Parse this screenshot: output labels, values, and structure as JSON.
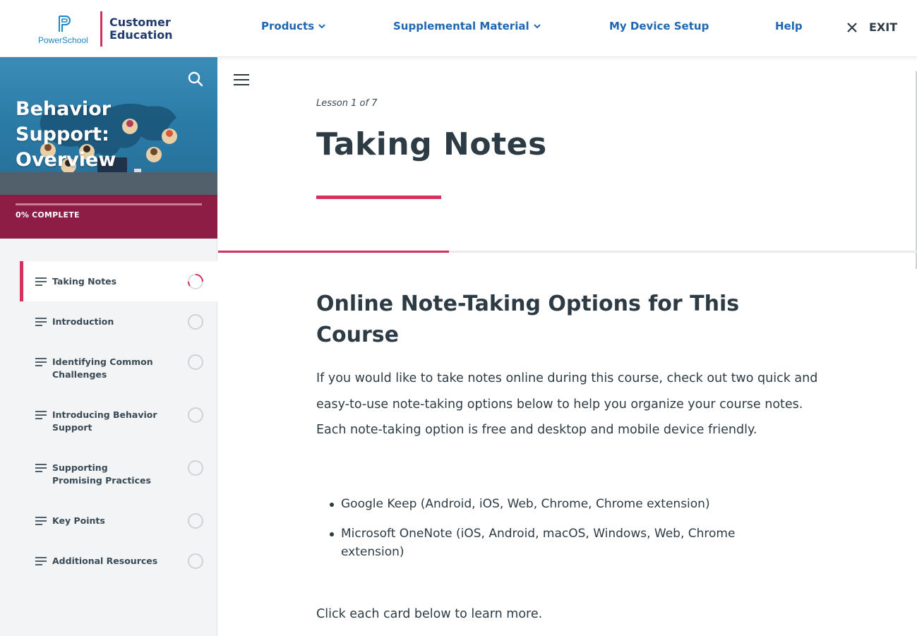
{
  "header": {
    "brand_mark": "PowerSchool",
    "brand_line1": "Customer",
    "brand_line2": "Education",
    "nav": [
      {
        "label": "Products",
        "has_dropdown": true
      },
      {
        "label": "Supplemental Material",
        "has_dropdown": true
      },
      {
        "label": "My Device Setup",
        "has_dropdown": false
      },
      {
        "label": "Help",
        "has_dropdown": false
      }
    ],
    "exit_label": "EXIT"
  },
  "sidebar": {
    "course_title": "Behavior Support: Overview",
    "progress_label": "0% COMPLETE",
    "progress_percent": 0,
    "lessons": [
      {
        "label": "Taking Notes",
        "status": "in-progress",
        "active": true
      },
      {
        "label": "Introduction",
        "status": "not-started",
        "active": false
      },
      {
        "label": "Identifying Common Challenges",
        "status": "not-started",
        "active": false
      },
      {
        "label": "Introducing Behavior Support",
        "status": "not-started",
        "active": false
      },
      {
        "label": "Supporting Promising Practices",
        "status": "not-started",
        "active": false
      },
      {
        "label": "Key Points",
        "status": "not-started",
        "active": false
      },
      {
        "label": "Additional Resources",
        "status": "not-started",
        "active": false
      }
    ]
  },
  "main": {
    "lesson_counter": "Lesson 1 of 7",
    "lesson_title": "Taking Notes",
    "lesson_progress_fraction": 0.33,
    "section_heading": "Online Note-Taking Options for This Course",
    "intro_paragraph": "If you would like to take notes online during this course, check out two quick and easy-to-use note-taking options below to help you organize your course notes. Each note-taking option is free and desktop and mobile device friendly.",
    "options": [
      "Google Keep (Android, iOS, Web, Chrome, Chrome extension)",
      "Microsoft OneNote (iOS, Android, macOS, Windows, Web, Chrome extension)"
    ],
    "click_note": "Click each card below to learn more."
  },
  "colors": {
    "accent": "#d6305f",
    "nav_blue": "#1d67b2",
    "progress_bg": "#8e1d46",
    "text": "#2d3b45"
  },
  "icons": {
    "search": "search-icon",
    "menu": "hamburger-menu-icon",
    "close": "close-icon",
    "lesson": "lesson-text-icon",
    "status": "status-circle-icon"
  }
}
